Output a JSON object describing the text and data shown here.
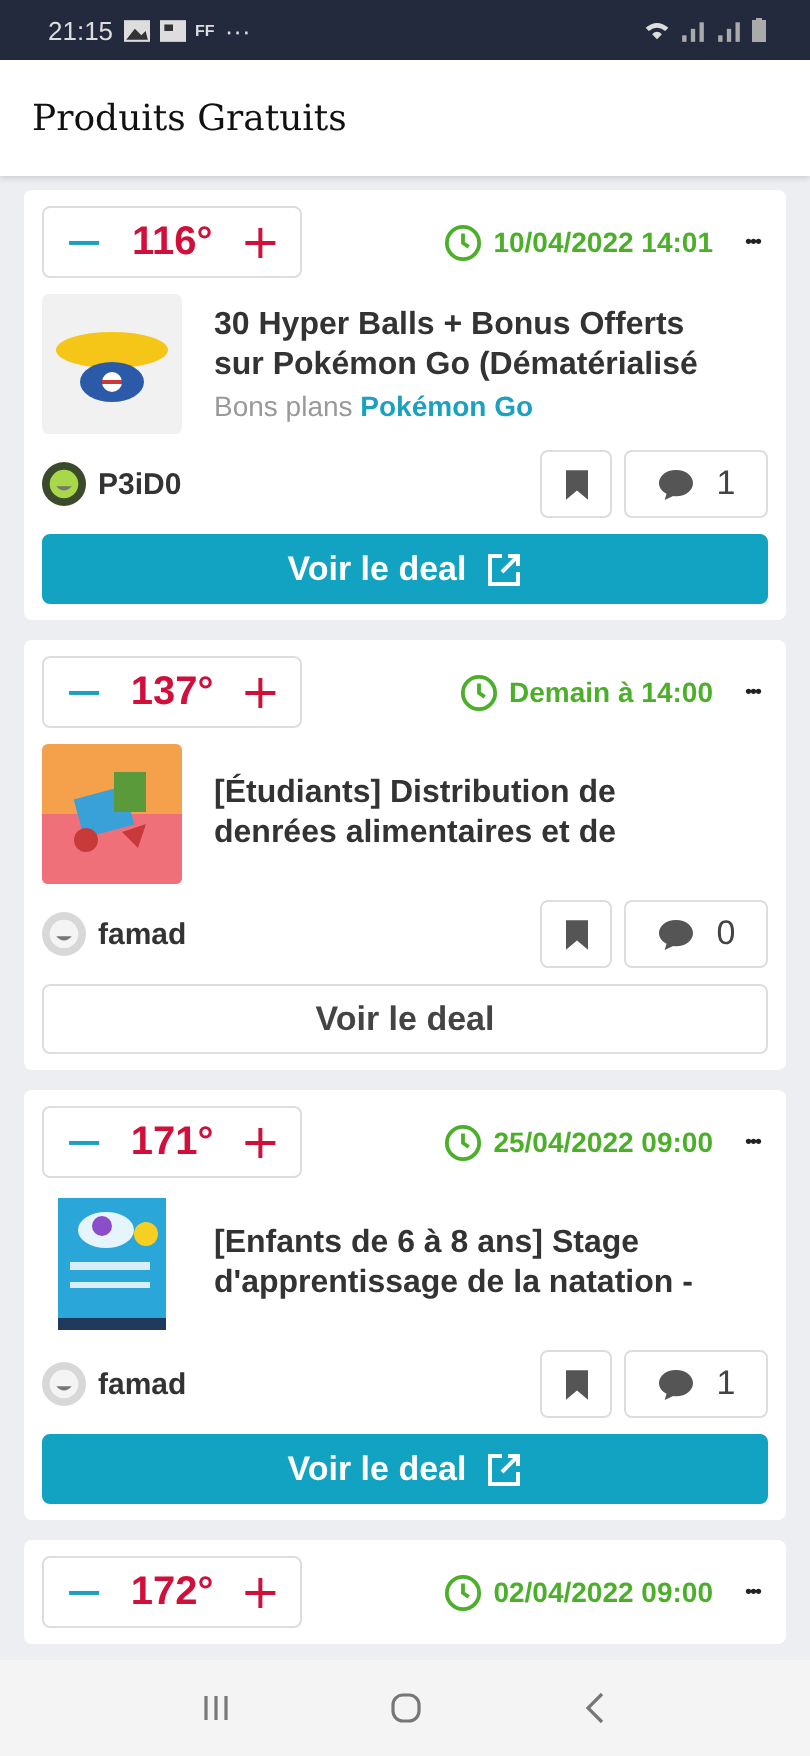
{
  "status_bar": {
    "time": "21:15",
    "text_icon": "FF",
    "more": "···"
  },
  "header": {
    "title": "Produits Gratuits"
  },
  "deals": [
    {
      "temperature": "116°",
      "minus": "−",
      "plus": "+",
      "expires": "10/04/2022 14:01",
      "more": "•••",
      "title": "30 Hyper Balls + Bonus Offerts sur Pokémon Go (Dématérialisé",
      "merchant_prefix": "Bons plans",
      "merchant": "Pokémon Go",
      "user": "P3iD0",
      "comments": "1",
      "button": "Voir le deal",
      "external": true
    },
    {
      "temperature": "137°",
      "minus": "−",
      "plus": "+",
      "expires": "Demain à 14:00",
      "more": "•••",
      "title": "[Étudiants] Distribution de denrées alimentaires et de",
      "user": "famad",
      "comments": "0",
      "button": "Voir le deal",
      "external": false
    },
    {
      "temperature": "171°",
      "minus": "−",
      "plus": "+",
      "expires": "25/04/2022 09:00",
      "more": "•••",
      "title": "[Enfants de 6 à 8 ans] Stage d'apprentissage de la natation -",
      "user": "famad",
      "comments": "1",
      "button": "Voir le deal",
      "external": true
    },
    {
      "temperature": "172°",
      "minus": "−",
      "plus": "+",
      "expires": "02/04/2022 09:00",
      "more": "•••"
    }
  ]
}
